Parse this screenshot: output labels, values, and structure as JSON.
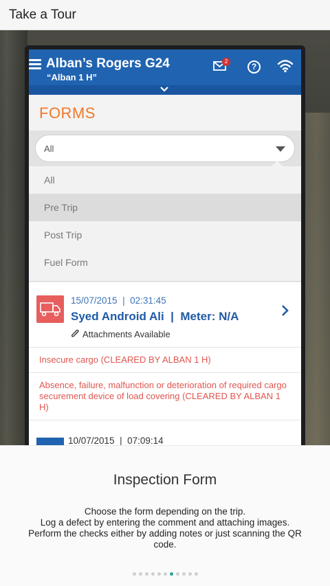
{
  "topbar": {
    "title": "Take a Tour"
  },
  "app": {
    "title": "Alban’s Rogers G24",
    "subtitle": "“Alban 1 H”",
    "mail_badge": "2",
    "help_glyph": "?"
  },
  "forms": {
    "heading": "FORMS",
    "filter_value": "All",
    "options": [
      "All",
      "Pre Trip",
      "Post Trip",
      "Fuel Form"
    ],
    "selected_option": "Pre Trip"
  },
  "entries": [
    {
      "datetime": "15/07/2015  |  02:31:45",
      "driver": "Syed Android Ali  |  Meter: N/A",
      "attachments": "Attachments Available",
      "defects": [
        "Insecure cargo (CLEARED BY ALBAN 1 H)",
        "Absence, failure, malfunction or deterioration of required cargo securement device of load covering (CLEARED BY ALBAN 1 H)"
      ]
    },
    {
      "datetime": "10/07/2015  |  07:09:14"
    }
  ],
  "tour": {
    "heading": "Inspection Form",
    "description": "Choose the form depending on the trip.\nLog a defect by entering the comment and attaching images.\nPerform the checks either by adding notes or just scanning the QR code.",
    "page_count": 11,
    "current_page": 6
  },
  "colors": {
    "app_blue": "#2063b0",
    "forms_orange": "#f0782a",
    "defect_red": "#e0554f",
    "active_dot": "#26a69a"
  },
  "icons": [
    "menu-icon",
    "mail-icon",
    "help-icon",
    "wifi-icon",
    "chevron-down-icon",
    "dropdown-arrow-icon",
    "truck-icon",
    "paperclip-icon",
    "chevron-right-icon"
  ]
}
